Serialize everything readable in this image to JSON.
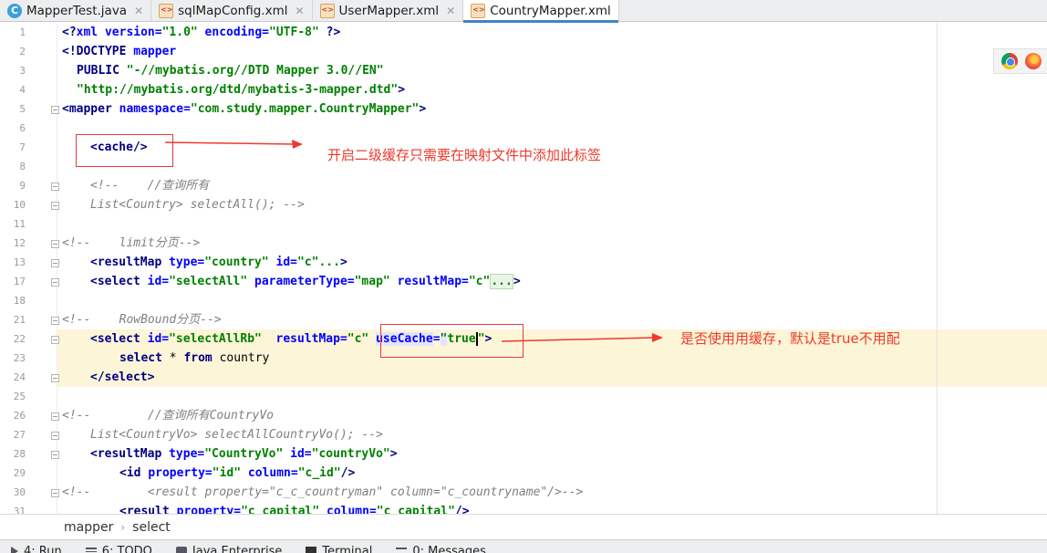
{
  "tabs": [
    {
      "label": "MapperTest.java",
      "icon": "java-class-icon",
      "active": false
    },
    {
      "label": "sqlMapConfig.xml",
      "icon": "xml-file-icon",
      "active": false
    },
    {
      "label": "UserMapper.xml",
      "icon": "xml-file-icon",
      "active": false
    },
    {
      "label": "CountryMapper.xml",
      "icon": "xml-file-icon",
      "active": true
    }
  ],
  "close_glyph": "✕",
  "line_numbers": [
    "1",
    "2",
    "3",
    "4",
    "5",
    "6",
    "7",
    "8",
    "9",
    "10",
    "11",
    "12",
    "13",
    "17",
    "18",
    "20",
    "21",
    "22",
    "23",
    "24",
    "25",
    "26",
    "27",
    "28",
    "29",
    "30",
    "31"
  ],
  "code": {
    "l1": [
      "<?",
      "xml ",
      "version=",
      "\"1.0\"",
      " encoding=",
      "\"UTF-8\"",
      " ?>"
    ],
    "l2": [
      "<!DOCTYPE ",
      "mapper"
    ],
    "l3": [
      "PUBLIC ",
      "\"-//mybatis.org//DTD Mapper 3.0//EN\""
    ],
    "l4": [
      "\"http://mybatis.org/dtd/mybatis-3-mapper.dtd\"",
      ">"
    ],
    "l5": [
      "<mapper ",
      "namespace=",
      "\"com.study.mapper.CountryMapper\"",
      ">"
    ],
    "l7": "<cache/>",
    "l9": "<!--    //查询所有",
    "l10": "List<Country> selectAll(); -->",
    "l12": "<!--    limit分页-->",
    "l13": [
      "<resultMap ",
      "type=",
      "\"country\"",
      " id=",
      "\"c\"",
      "...",
      ">"
    ],
    "l17": [
      "<select ",
      "id=",
      "\"selectAll\"",
      " parameterType=",
      "\"map\"",
      " resultMap=",
      "\"c\"",
      "...",
      ">"
    ],
    "l21": "<!--    RowBound分页-->",
    "l22": [
      "<select ",
      "id=",
      "\"selectAllRb\"",
      "  resultMap=",
      "\"c\"",
      " ",
      "useCache",
      "=",
      "\"",
      "true",
      "\"",
      ">"
    ],
    "l23": [
      "select ",
      "* ",
      "from ",
      "country"
    ],
    "l24": "</select>",
    "l26": "<!--        //查询所有CountryVo",
    "l27": "List<CountryVo> selectAllCountryVo(); -->",
    "l28": [
      "<resultMap ",
      "type=",
      "\"CountryVo\"",
      " id=",
      "\"countryVo\"",
      ">"
    ],
    "l29": [
      "<id ",
      "property=",
      "\"id\"",
      " column=",
      "\"c_id\"",
      "/>"
    ],
    "l30": [
      "<!--",
      "        <result property=\"c_c_countryman\" column=\"c_countryname\"/>-->"
    ],
    "l31": [
      "<result ",
      "property=",
      "\"c_capital\"",
      " column=",
      "\"c_capital\"",
      "/>"
    ]
  },
  "annotations": {
    "cache_note": "开启二级缓存只需要在映射文件中添加此标签",
    "usecache_note": "是否使用用缓存，默认是true不用配"
  },
  "breadcrumb": [
    "mapper",
    "select"
  ],
  "breadcrumb_sep": "›",
  "tool_windows": [
    "4: Run",
    "6: TODO",
    "Java Enterprise",
    "Terminal",
    "0: Messages"
  ],
  "colors": {
    "tag": "#000080",
    "attribute": "#0000ff",
    "string": "#008000",
    "comment": "#808080",
    "annotation": "#ee3a2c",
    "current_line": "#fdf5d8",
    "active_tab_accent": "#4083c9"
  }
}
